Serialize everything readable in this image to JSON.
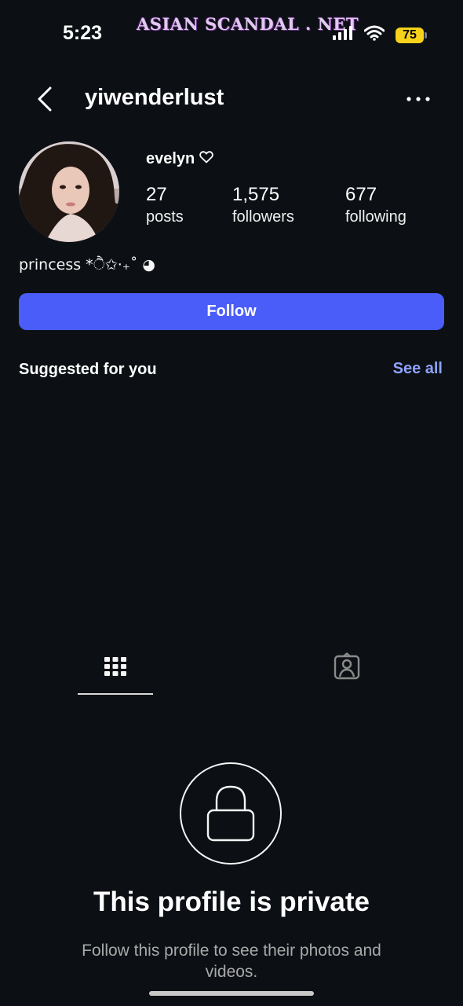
{
  "status_bar": {
    "time": "5:23",
    "watermark": "ASIAN SCANDAL . NET",
    "battery": "75"
  },
  "header": {
    "username": "yiwenderlust"
  },
  "profile": {
    "display_name": "evelyn",
    "stats": [
      {
        "value": "27",
        "label": "posts"
      },
      {
        "value": "1,575",
        "label": "followers"
      },
      {
        "value": "677",
        "label": "following"
      }
    ],
    "bio": "princess *ੈ✩‧₊˚ ◕"
  },
  "actions": {
    "follow_label": "Follow"
  },
  "suggested": {
    "title": "Suggested for you",
    "see_all": "See all"
  },
  "private": {
    "title": "This profile is private",
    "subtitle": "Follow this profile to see their photos and videos."
  },
  "colors": {
    "background": "#0c1014",
    "accent": "#4a5df9",
    "link": "#8ea2ff",
    "battery": "#f7d21a"
  }
}
